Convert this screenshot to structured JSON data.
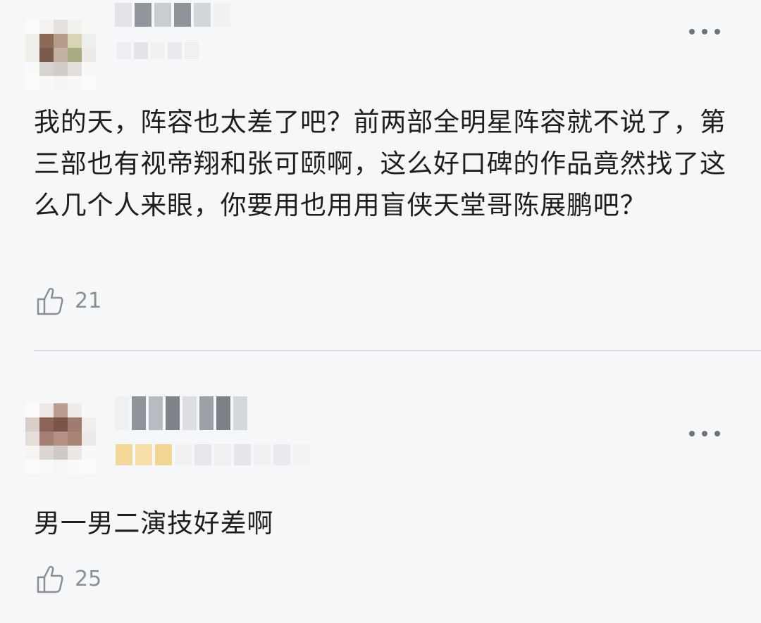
{
  "comments": [
    {
      "text": "我的天，阵容也太差了吧？前两部全明星阵容就不说了，第三部也有视帝翔和张可颐啊，这么好口碑的作品竟然找了这么几个人来眼，你要用也用用盲侠天堂哥陈展鹏吧？",
      "likes": "21",
      "more_icon": "more-dots-icon",
      "like_icon": "thumbs-up-icon"
    },
    {
      "text": "男一男二演技好差啊",
      "likes": "25",
      "more_icon": "more-dots-icon",
      "like_icon": "thumbs-up-icon"
    }
  ],
  "colors": {
    "background": "#f6f7f9",
    "text": "#1e1e1e",
    "muted": "#8b8f94",
    "divider": "#d8dbe0",
    "badge": "#f4d79a"
  }
}
